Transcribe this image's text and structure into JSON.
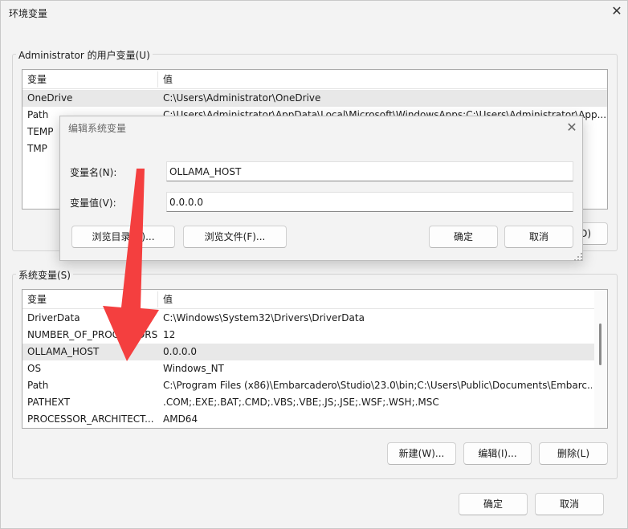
{
  "window": {
    "title": "环境变量",
    "close_glyph": "✕"
  },
  "user_vars": {
    "group_label": "Administrator 的用户变量(U)",
    "columns": [
      "变量",
      "值"
    ],
    "rows": [
      {
        "name": "OneDrive",
        "value": "C:\\Users\\Administrator\\OneDrive"
      },
      {
        "name": "Path",
        "value": "C:\\Users\\Administrator\\AppData\\Local\\Microsoft\\WindowsApps;C:\\Users\\Administrator\\App..."
      },
      {
        "name": "TEMP",
        "value": ""
      },
      {
        "name": "TMP",
        "value": ""
      }
    ],
    "hidden_button_tail": "D)"
  },
  "system_vars": {
    "group_label": "系统变量(S)",
    "columns": [
      "变量",
      "值"
    ],
    "rows": [
      {
        "name": "DriverData",
        "value": "C:\\Windows\\System32\\Drivers\\DriverData"
      },
      {
        "name": "NUMBER_OF_PROCESSORS",
        "value": "12"
      },
      {
        "name": "OLLAMA_HOST",
        "value": "0.0.0.0"
      },
      {
        "name": "OS",
        "value": "Windows_NT"
      },
      {
        "name": "Path",
        "value": "C:\\Program Files (x86)\\Embarcadero\\Studio\\23.0\\bin;C:\\Users\\Public\\Documents\\Embarc..."
      },
      {
        "name": "PATHEXT",
        "value": ".COM;.EXE;.BAT;.CMD;.VBS;.VBE;.JS;.JSE;.WSF;.WSH;.MSC"
      },
      {
        "name": "PROCESSOR_ARCHITECT...",
        "value": "AMD64"
      }
    ],
    "buttons": {
      "new": "新建(W)...",
      "edit": "编辑(I)...",
      "delete": "删除(L)"
    }
  },
  "footer": {
    "ok": "确定",
    "cancel": "取消"
  },
  "edit_dialog": {
    "title": "编辑系统变量",
    "close_glyph": "✕",
    "name_label": "变量名(N):",
    "name_value": "OLLAMA_HOST",
    "value_label": "变量值(V):",
    "value_value": "0.0.0.0",
    "browse_dir": "浏览目录(D)...",
    "browse_file": "浏览文件(F)...",
    "ok": "确定",
    "cancel": "取消"
  },
  "colors": {
    "arrow": "#f43f3f",
    "selected_row": "#e8e8e8",
    "window_bg": "#f3f3f3"
  }
}
